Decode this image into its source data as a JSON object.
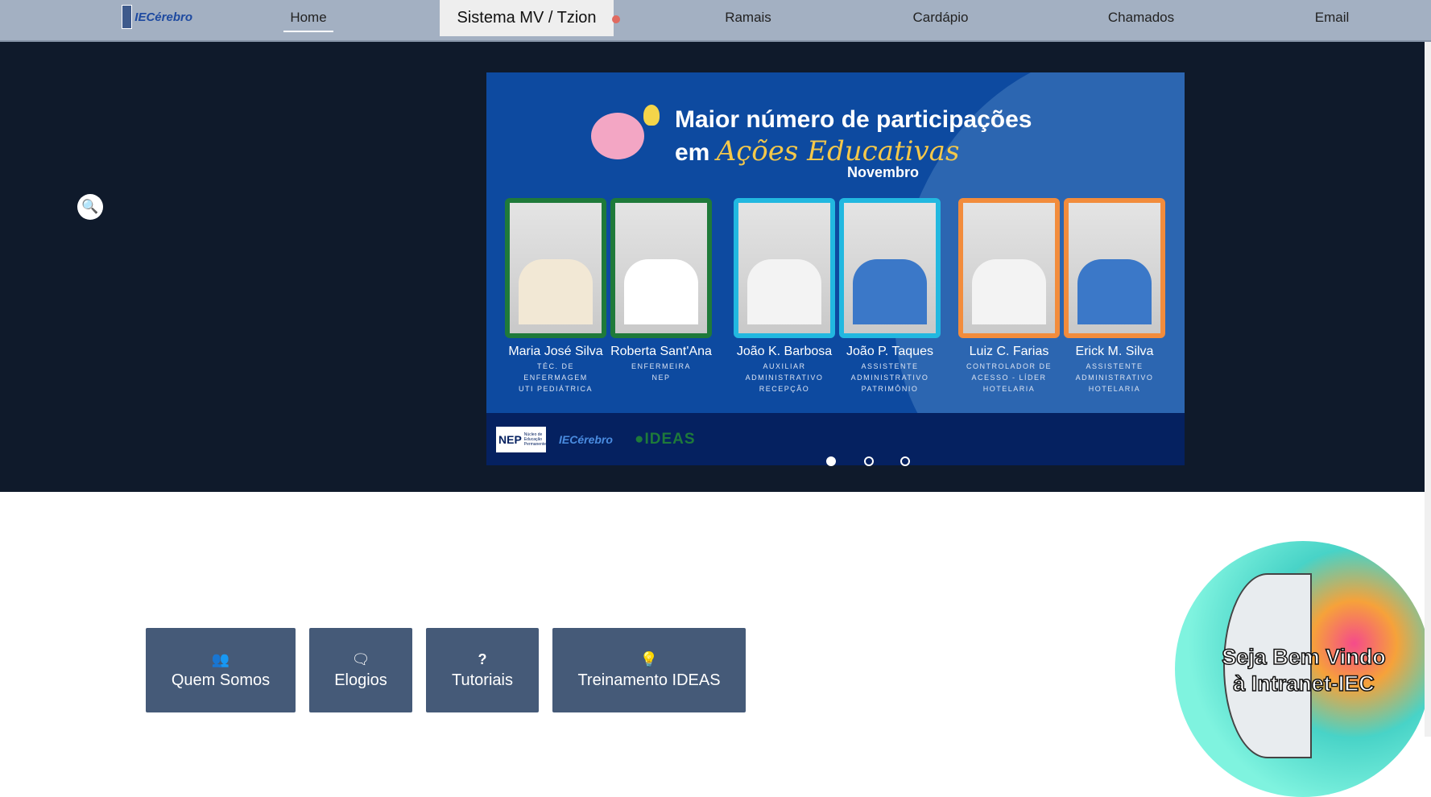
{
  "nav": {
    "logo_text": "IECérebro",
    "items": [
      {
        "label": "Home"
      },
      {
        "label": "Sistema MV / Tzion"
      },
      {
        "label": "Ramais"
      },
      {
        "label": "Cardápio"
      },
      {
        "label": "Chamados"
      },
      {
        "label": "Email"
      }
    ]
  },
  "banner": {
    "title": "Maior número de participações",
    "subtitle_prefix": "em",
    "subtitle_script": "Ações Educativas",
    "month": "Novembro",
    "people": [
      {
        "name": "Maria José Silva",
        "role": [
          "TÉC. DE ENFERMAGEM",
          "UTI PEDIÁTRICA"
        ],
        "color": "#1f7a3a",
        "shirt": "#f2e8d5"
      },
      {
        "name": "Roberta Sant'Ana",
        "role": [
          "ENFERMEIRA",
          "NEP"
        ],
        "color": "#1f7a3a",
        "shirt": "#ffffff"
      },
      {
        "name": "João K. Barbosa",
        "role": [
          "AUXILIAR",
          "ADMINISTRATIVO",
          "RECEPÇÃO"
        ],
        "color": "#22b8e0",
        "shirt": "#f3f3f3"
      },
      {
        "name": "João P. Taques",
        "role": [
          "ASSISTENTE",
          "ADMINISTRATIVO",
          "PATRIMÔNIO"
        ],
        "color": "#22b8e0",
        "shirt": "#3b78c8"
      },
      {
        "name": "Luiz C. Farias",
        "role": [
          "CONTROLADOR DE",
          "ACESSO - LÍDER",
          "HOTELARIA"
        ],
        "color": "#f28c3c",
        "shirt": "#f3f3f3"
      },
      {
        "name": "Erick M. Silva",
        "role": [
          "ASSISTENTE",
          "ADMINISTRATIVO",
          "HOTELARIA"
        ],
        "color": "#f28c3c",
        "shirt": "#3b78c8"
      }
    ],
    "footer_logos": {
      "nep": "NEP",
      "nep_sub": "Núcleo de Educação Permanente",
      "iec": "IECérebro",
      "ideas": "IDEAS"
    }
  },
  "carousel": {
    "slides": 3,
    "active": 1
  },
  "buttons": [
    {
      "label": "Quem Somos",
      "icon": "users-icon"
    },
    {
      "label": "Elogios",
      "icon": "comment-icon"
    },
    {
      "label": "Tutoriais",
      "icon": "question-icon"
    },
    {
      "label": "Treinamento IDEAS",
      "icon": "lightbulb-icon"
    }
  ],
  "welcome": {
    "line1": "Seja Bem Vindo",
    "line2": "à Intranet-IEC"
  }
}
